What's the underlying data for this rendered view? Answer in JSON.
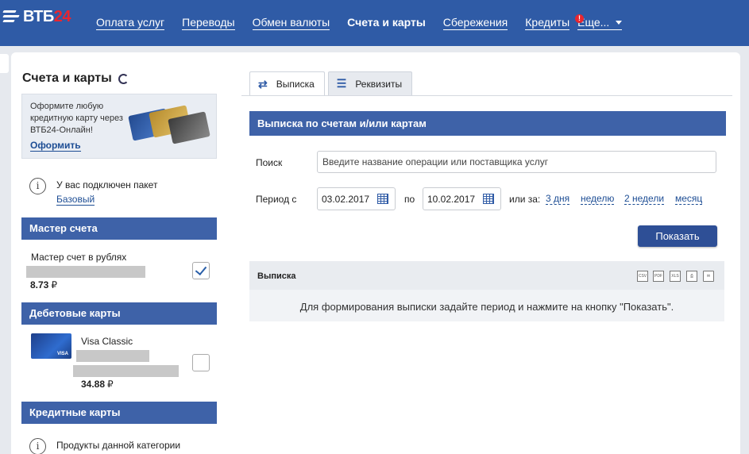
{
  "brand": {
    "logo_text": "ВТБ",
    "logo_accent": "24"
  },
  "nav": {
    "items": [
      "Оплата услуг",
      "Переводы",
      "Обмен валюты",
      "Счета и карты",
      "Сбережения",
      "Кредиты"
    ],
    "active": "Счета и карты",
    "badge": "!",
    "more_label": "Еще..."
  },
  "sidebar": {
    "title": "Счета и карты",
    "promo": {
      "text": "Оформите любую кредитную карту через ВТБ24-Онлайн!",
      "link": "Оформить"
    },
    "package": {
      "text": "У вас подключен пакет",
      "link": "Базовый"
    },
    "sections": {
      "master": {
        "title": "Мастер счета",
        "account_label": "Мастер счет в рублях",
        "amount": "8.73",
        "currency": "₽",
        "checked": true
      },
      "debit": {
        "title": "Дебетовые карты",
        "card_name": "Visa Classic",
        "amount": "34.88",
        "currency": "₽",
        "checked": false
      },
      "credit": {
        "title": "Кредитные карты",
        "empty_text": "Продукты данной категории отсутствуют"
      }
    }
  },
  "main": {
    "tabs": [
      {
        "label": "Выписка",
        "icon": "arrows-icon",
        "active": true
      },
      {
        "label": "Реквизиты",
        "icon": "list-icon",
        "active": false
      }
    ],
    "statement_title": "Выписка по счетам и/или картам",
    "search": {
      "label": "Поиск",
      "placeholder": "Введите название операции или поставщика услуг"
    },
    "period": {
      "label": "Период с",
      "from": "03.02.2017",
      "to_label": "по",
      "to": "10.02.2017",
      "or_label": "или за:",
      "quick": [
        "3 дня",
        "неделю",
        "2 недели",
        "месяц"
      ]
    },
    "show_button": "Показать",
    "result": {
      "title": "Выписка",
      "export_icons": [
        "csv-icon",
        "pdf-icon",
        "xls-icon",
        "print-icon",
        "email-icon"
      ],
      "message": "Для формирования выписки задайте период и нажмите на кнопку \"Показать\"."
    }
  },
  "colors": {
    "nav_bg": "#2f5ba6",
    "section_head": "#3e62a8",
    "accent_red": "#e9262f",
    "link": "#1d4d94",
    "button": "#2e4f96"
  }
}
